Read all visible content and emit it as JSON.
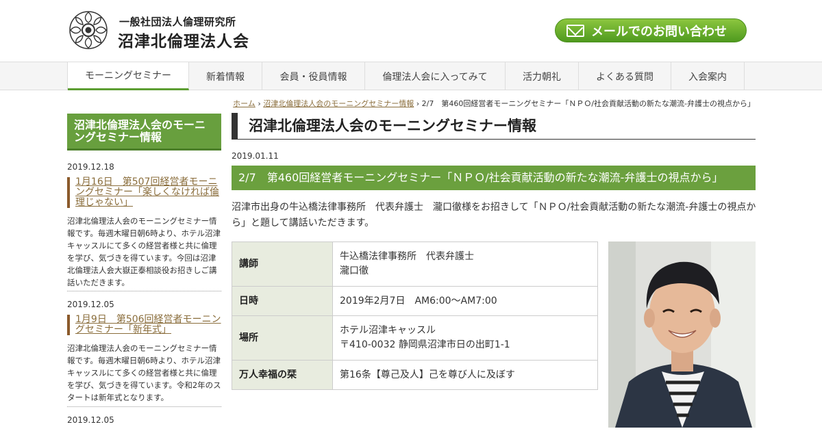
{
  "header": {
    "org_small": "一般社団法人倫理研究所",
    "org_big": "沼津北倫理法人会",
    "mail_button": "メールでのお問い合わせ",
    "logo_icon": "org-seal-icon",
    "mail_icon": "envelope-icon"
  },
  "nav": {
    "items": [
      "モーニングセミナー",
      "新着情報",
      "会員・役員情報",
      "倫理法人会に入ってみて",
      "活力朝礼",
      "よくある質問",
      "入会案内"
    ],
    "active": 0
  },
  "breadcrumb": {
    "home": "ホーム",
    "separator": "›",
    "category": "沼津北倫理法人会のモーニングセミナー情報",
    "current": "2/7　第460回経営者モーニングセミナー「ＮＰＯ/社会貢献活動の新たな潮流-弁護士の視点から」"
  },
  "sidebar": {
    "heading": "沼津北倫理法人会のモーニングセミナー情報",
    "items": [
      {
        "date": "2019.12.18",
        "title": "1月16日　第507回経営者モーニングセミナー「楽しくなければ倫理じゃない」",
        "desc": "沼津北倫理法人会のモーニングセミナー情報です。毎週木曜日朝6時より、ホテル沼津キャッスルにて多くの経営者様と共に倫理を学び、気づきを得ています。今回は沼津北倫理法人会大嶽正泰相談役お招きしご講話いただきます。"
      },
      {
        "date": "2019.12.05",
        "title": "1月9日　第506回経営者モーニングセミナー「新年式」",
        "desc": "沼津北倫理法人会のモーニングセミナー情報です。毎週木曜日朝6時より、ホテル沼津キャッスルにて多くの経営者様と共に倫理を学び、気づきを得ています。令和2年のスタートは新年式となります。"
      },
      {
        "date": "2019.12.05",
        "title": "",
        "desc": ""
      }
    ]
  },
  "main": {
    "title": "沼津北倫理法人会のモーニングセミナー情報",
    "date": "2019.01.11",
    "post_title": "2/7　第460回経営者モーニングセミナー「ＮＰＯ/社会貢献活動の新たな潮流-弁護士の視点から」",
    "body": "沼津市出身の牛込橋法律事務所　代表弁護士　瀧口徹様をお招きして「ＮＰＯ/社会貢献活動の新たな潮流-弁護士の視点から」と題して講話いただきます。",
    "table": [
      {
        "key": "講師",
        "lines": [
          "牛込橋法律事務所　代表弁護士",
          "瀧口徹"
        ]
      },
      {
        "key": "日時",
        "lines": [
          "2019年2月7日　AM6:00～AM7:00"
        ]
      },
      {
        "key": "場所",
        "lines": [
          "ホテル沼津キャッスル",
          "〒410-0032 静岡県沼津市日の出町1-1"
        ]
      },
      {
        "key": "万人幸福の栞",
        "lines": [
          "第16条【尊己及人】己を尊び人に及ぼす"
        ]
      }
    ],
    "photo_icon": "speaker-portrait"
  },
  "colors": {
    "green": "#6ba03e",
    "green_dark": "#4c7f2a",
    "link_brown": "#8a6d3b",
    "table_key_bg": "#e8ecdf"
  }
}
